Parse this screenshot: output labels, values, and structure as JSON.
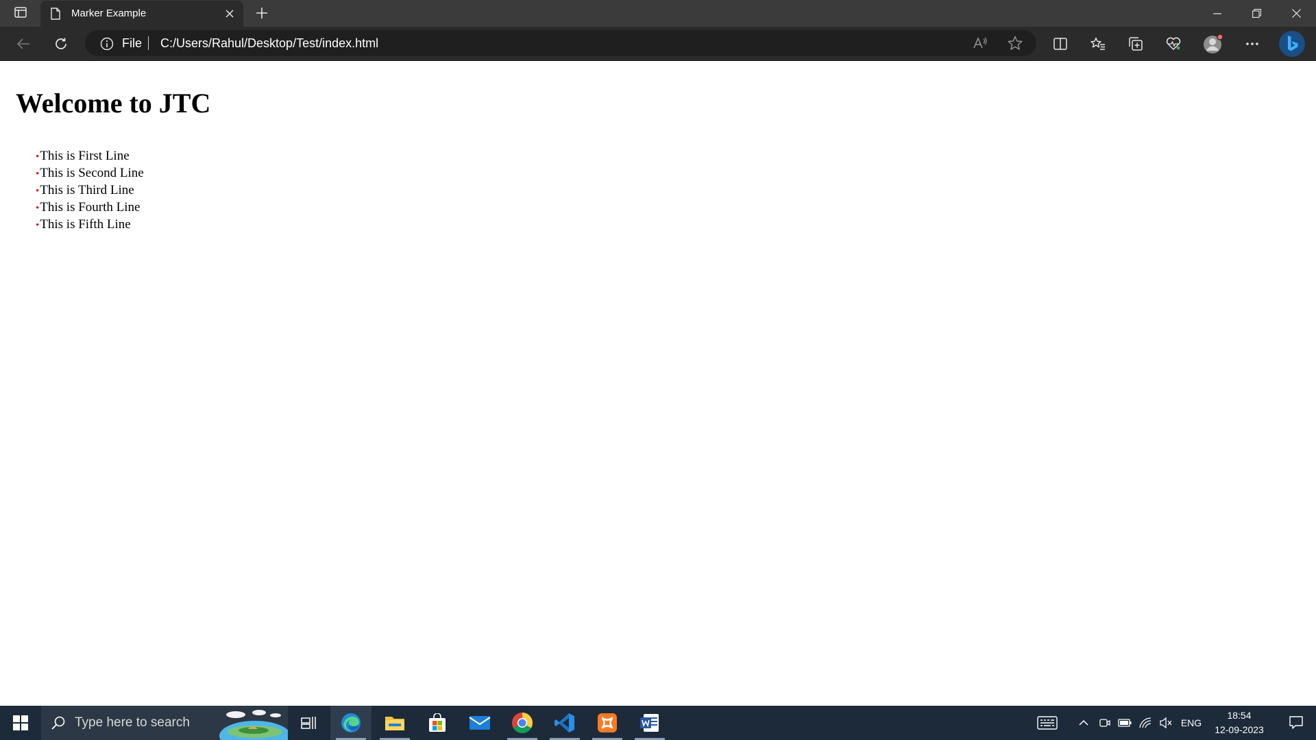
{
  "browser": {
    "tab": {
      "title": "Marker Example",
      "icon": "page-icon",
      "close_icon": "close-icon"
    },
    "new_tab_icon": "plus-icon",
    "window_controls": [
      "minimize-icon",
      "restore-icon",
      "close-icon"
    ],
    "address": {
      "scheme_label": "File",
      "url": "C:/Users/Rahul/Desktop/Test/index.html"
    },
    "toolbar_icons": [
      "back-icon",
      "refresh-icon",
      "read-aloud-icon",
      "favorite-star-icon",
      "split-screen-icon",
      "favorites-icon",
      "collections-icon",
      "browser-essentials-icon",
      "profile-icon",
      "more-icon",
      "bing-icon"
    ]
  },
  "page": {
    "heading": "Welcome to JTC",
    "marker_char": "•",
    "marker_color": "#e01010",
    "items": [
      "This is First Line",
      "This is Second Line",
      "This is Third Line",
      "This is Fourth Line",
      "This is Fifth Line"
    ]
  },
  "taskbar": {
    "search_placeholder": "Type here to search",
    "apps": [
      "task-view-icon",
      "edge-icon",
      "file-explorer-icon",
      "microsoft-store-icon",
      "mail-icon",
      "chrome-icon",
      "vscode-icon",
      "xampp-icon",
      "word-icon"
    ],
    "tray": {
      "language": "ENG",
      "time": "18:54",
      "date": "12-09-2023"
    }
  },
  "colors": {
    "titlebar": "#3b3b3b",
    "toolbar": "#2b2b2b",
    "addressbar": "#1f1f1f",
    "taskbar": "#1c2a3a",
    "edge_accent": "#1f8ad6"
  }
}
